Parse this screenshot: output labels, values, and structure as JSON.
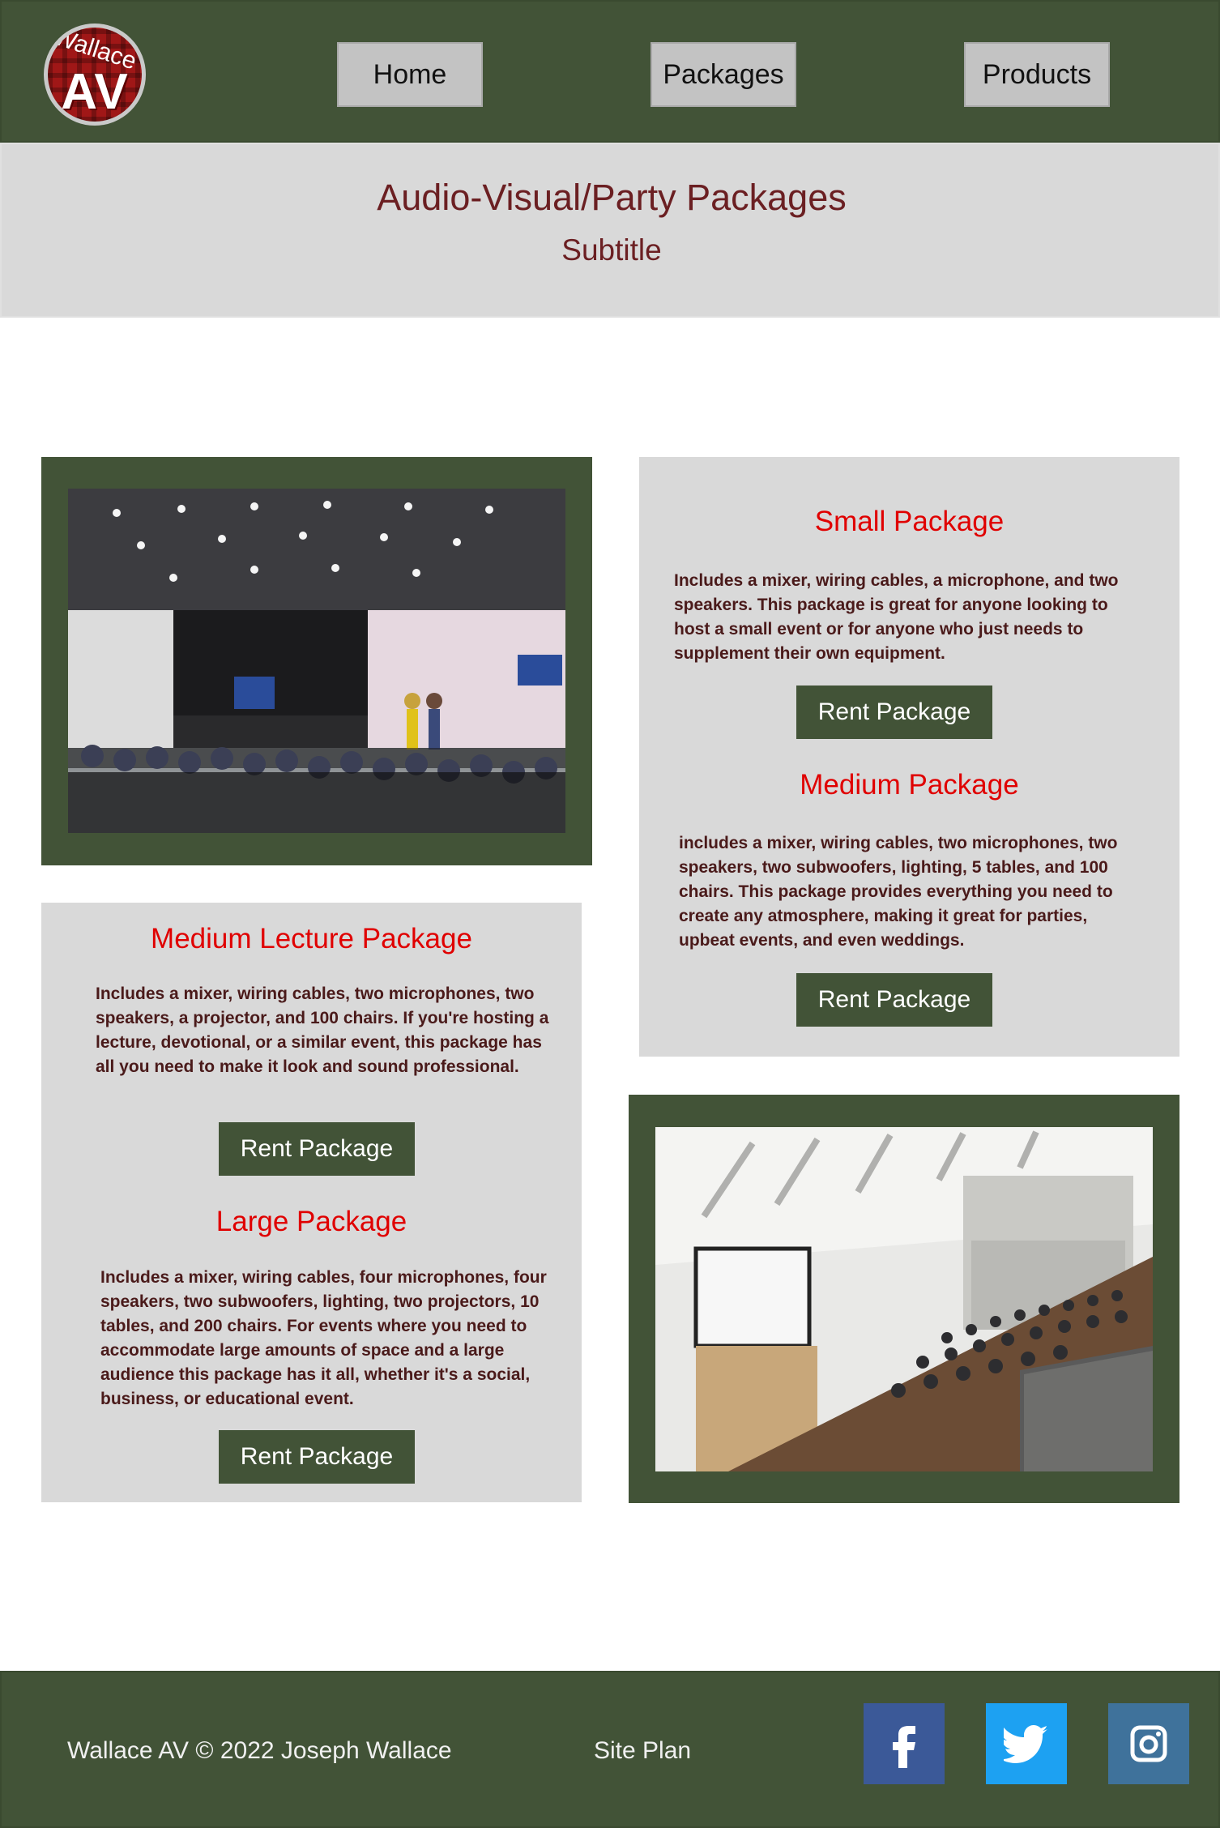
{
  "header": {
    "logo_text_top": "Wallace",
    "logo_text_main": "AV",
    "nav": [
      {
        "label": "Home"
      },
      {
        "label": "Packages"
      },
      {
        "label": "Products"
      }
    ]
  },
  "hero": {
    "title": "Audio-Visual/Party Packages",
    "subtitle": "Subtitle"
  },
  "packages": {
    "small": {
      "title": "Small Package",
      "description": "Includes a mixer, wiring cables, a microphone, and two speakers. This package is great for anyone looking to host a small event or for anyone who just needs to supplement their own equipment.",
      "button": "Rent Package"
    },
    "medium": {
      "title": "Medium Package",
      "description": "includes a mixer, wiring cables, two microphones, two speakers, two subwoofers, lighting, 5 tables, and 100 chairs. This package provides everything you need to create any atmosphere, making it great for parties, upbeat events, and even weddings.",
      "button": "Rent Package"
    },
    "medium_lecture": {
      "title": "Medium Lecture Package",
      "description": "Includes a mixer, wiring cables, two microphones, two speakers, a projector, and 100 chairs. If you're hosting a lecture, devotional, or a similar event, this package has all you need to make it look and sound professional.",
      "button": "Rent Package"
    },
    "large": {
      "title": "Large Package",
      "description": "Includes a mixer, wiring cables, four microphones, four speakers, two subwoofers, lighting, two projectors, 10 tables, and 200 chairs. For events where you need to accommodate large amounts of space and a large audience this package has it all, whether it's a social, business, or educational event.",
      "button": "Rent Package"
    }
  },
  "footer": {
    "copyright": "Wallace AV © 2022 Joseph Wallace",
    "site_plan": "Site Plan",
    "social": [
      {
        "name": "facebook",
        "color": "#3b5998"
      },
      {
        "name": "twitter",
        "color": "#1da1f2"
      },
      {
        "name": "instagram",
        "color": "#3f729b"
      }
    ]
  },
  "colors": {
    "brand_green": "#425337",
    "panel_gray": "#d9d9d9",
    "title_red": "#e00000",
    "hero_text": "#6b1f22"
  }
}
